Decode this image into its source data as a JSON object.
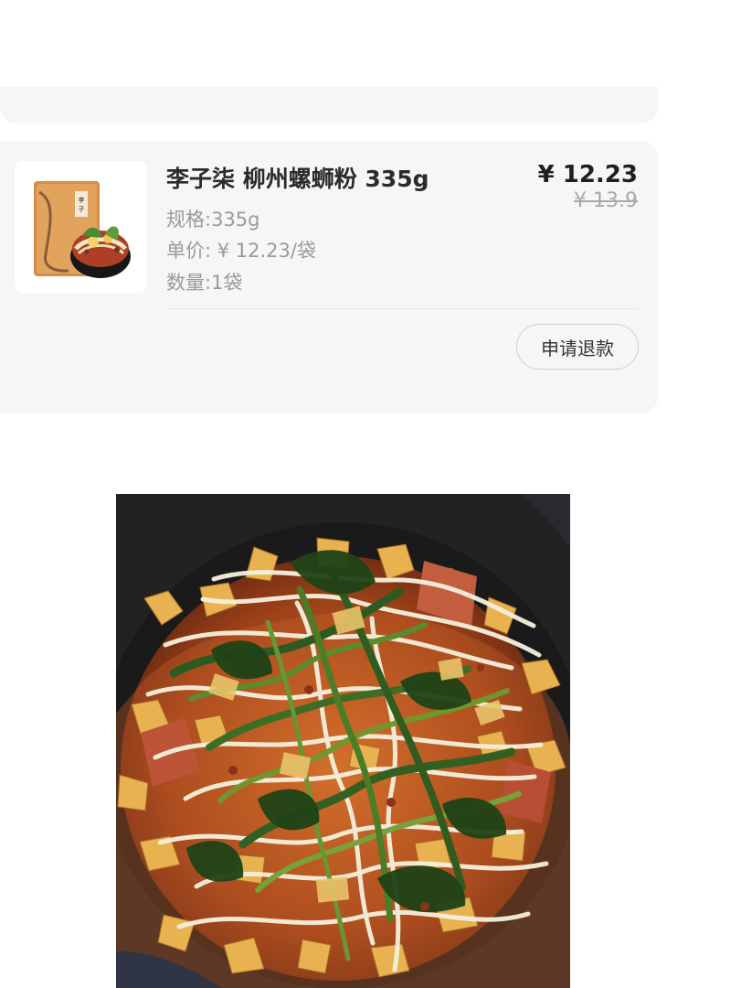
{
  "order": {
    "product_title": "李子柒 柳州螺蛳粉 335g",
    "current_price": "¥ 12.23",
    "original_price": "¥ 13.9",
    "spec": "规格:335g",
    "unit_price": "单价: ¥ 12.23/袋",
    "quantity": "数量:1袋",
    "refund_button": "申请退款"
  },
  "icons": {
    "product_image": "snail-noodle-package-image",
    "food_image": "cooked-noodles-photo"
  },
  "colors": {
    "card_background": "#f6f6f6",
    "title_text": "#2b2b2b",
    "muted_text": "#9a9a9a",
    "strike_price": "#a9a9a9"
  }
}
